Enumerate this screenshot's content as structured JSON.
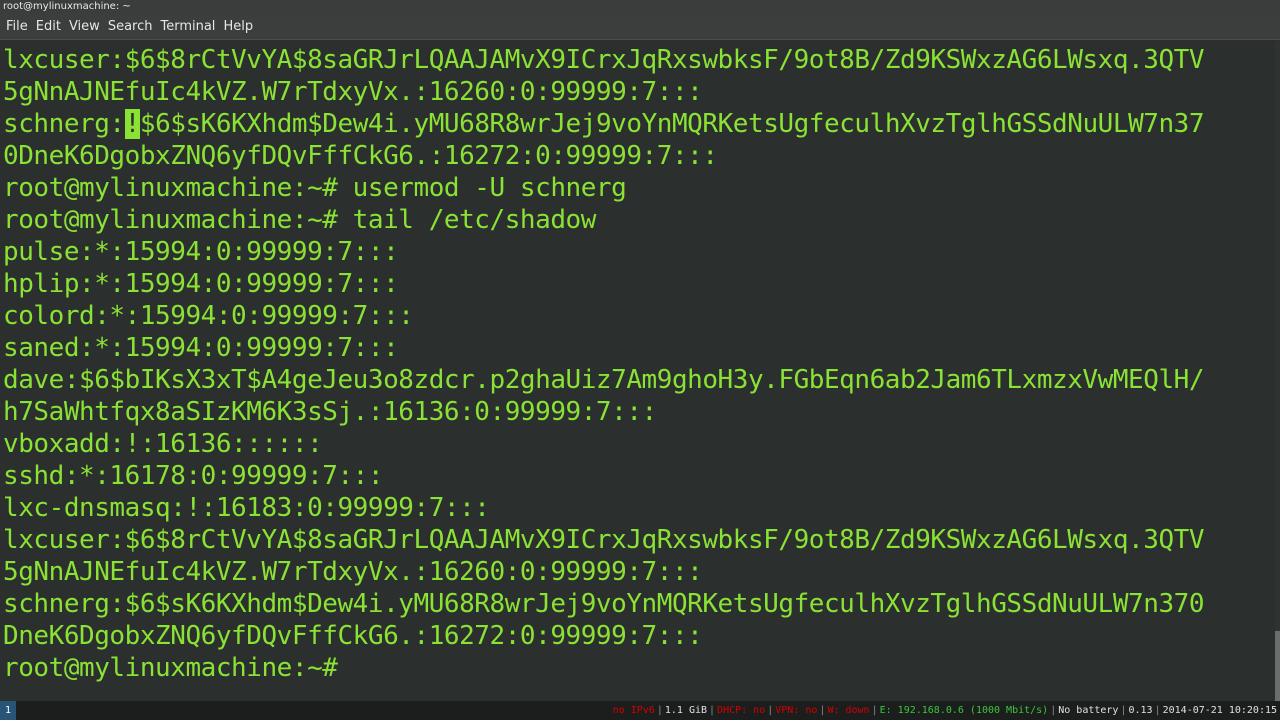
{
  "window": {
    "title": "root@mylinuxmachine: ~"
  },
  "menu": [
    "File",
    "Edit",
    "View",
    "Search",
    "Terminal",
    "Help"
  ],
  "terminal": {
    "colors": {
      "background": "#2b2f2e",
      "text": "#8ae234"
    },
    "lines": [
      "lxcuser:$6$8rCtVvYA$8saGRJrLQAAJAMvX9ICrxJqRxswbksF/9ot8B/Zd9KSWxzAG6LWsxq.3QTV",
      "5gNnAJNEfuIc4kVZ.W7rTdxyVx.:16260:0:99999:7:::",
      {
        "before": "schnerg:",
        "cursor": "!",
        "after": "$6$sK6KXhdm$Dew4i.yMU68R8wrJej9voYnMQRKetsUgfeculhXvzTglhGSSdNuULW7n37"
      },
      "0DneK6DgobxZNQ6yfDQvFffCkG6.:16272:0:99999:7:::",
      "root@mylinuxmachine:~# usermod -U schnerg",
      "root@mylinuxmachine:~# tail /etc/shadow",
      "pulse:*:15994:0:99999:7:::",
      "hplip:*:15994:0:99999:7:::",
      "colord:*:15994:0:99999:7:::",
      "saned:*:15994:0:99999:7:::",
      "dave:$6$bIKsX3xT$A4geJeu3o8zdcr.p2ghaUiz7Am9ghoH3y.FGbEqn6ab2Jam6TLxmzxVwMEQlH/",
      "h7SaWhtfqx8aSIzKM6K3sSj.:16136:0:99999:7:::",
      "vboxadd:!:16136::::::",
      "sshd:*:16178:0:99999:7:::",
      "lxc-dnsmasq:!:16183:0:99999:7:::",
      "lxcuser:$6$8rCtVvYA$8saGRJrLQAAJAMvX9ICrxJqRxswbksF/9ot8B/Zd9KSWxzAG6LWsxq.3QTV",
      "5gNnAJNEfuIc4kVZ.W7rTdxyVx.:16260:0:99999:7:::",
      "schnerg:$6$sK6KXhdm$Dew4i.yMU68R8wrJej9voYnMQRKetsUgfeculhXvzTglhGSSdNuULW7n370",
      "DneK6DgobxZNQ6yfDQvFffCkG6.:16272:0:99999:7:::",
      "root@mylinuxmachine:~#"
    ]
  },
  "statusbar": {
    "workspace": "1",
    "items": [
      {
        "text": "no IPv6",
        "state": "bad"
      },
      {
        "text": "1.1 GiB",
        "state": "neutral"
      },
      {
        "text": "DHCP: no",
        "state": "bad"
      },
      {
        "text": "VPN: no",
        "state": "bad"
      },
      {
        "text": "W: down",
        "state": "bad"
      },
      {
        "text": "E: 192.168.0.6 (1000 Mbit/s)",
        "state": "good"
      },
      {
        "text": "No battery",
        "state": "neutral"
      },
      {
        "text": "0.13",
        "state": "neutral"
      },
      {
        "text": "2014-07-21 10:20:15",
        "state": "neutral"
      }
    ],
    "colors": {
      "bad": "#d40000",
      "good": "#3ac63a",
      "neutral": "#e0e0e0",
      "workspace_bg": "#285577"
    }
  }
}
